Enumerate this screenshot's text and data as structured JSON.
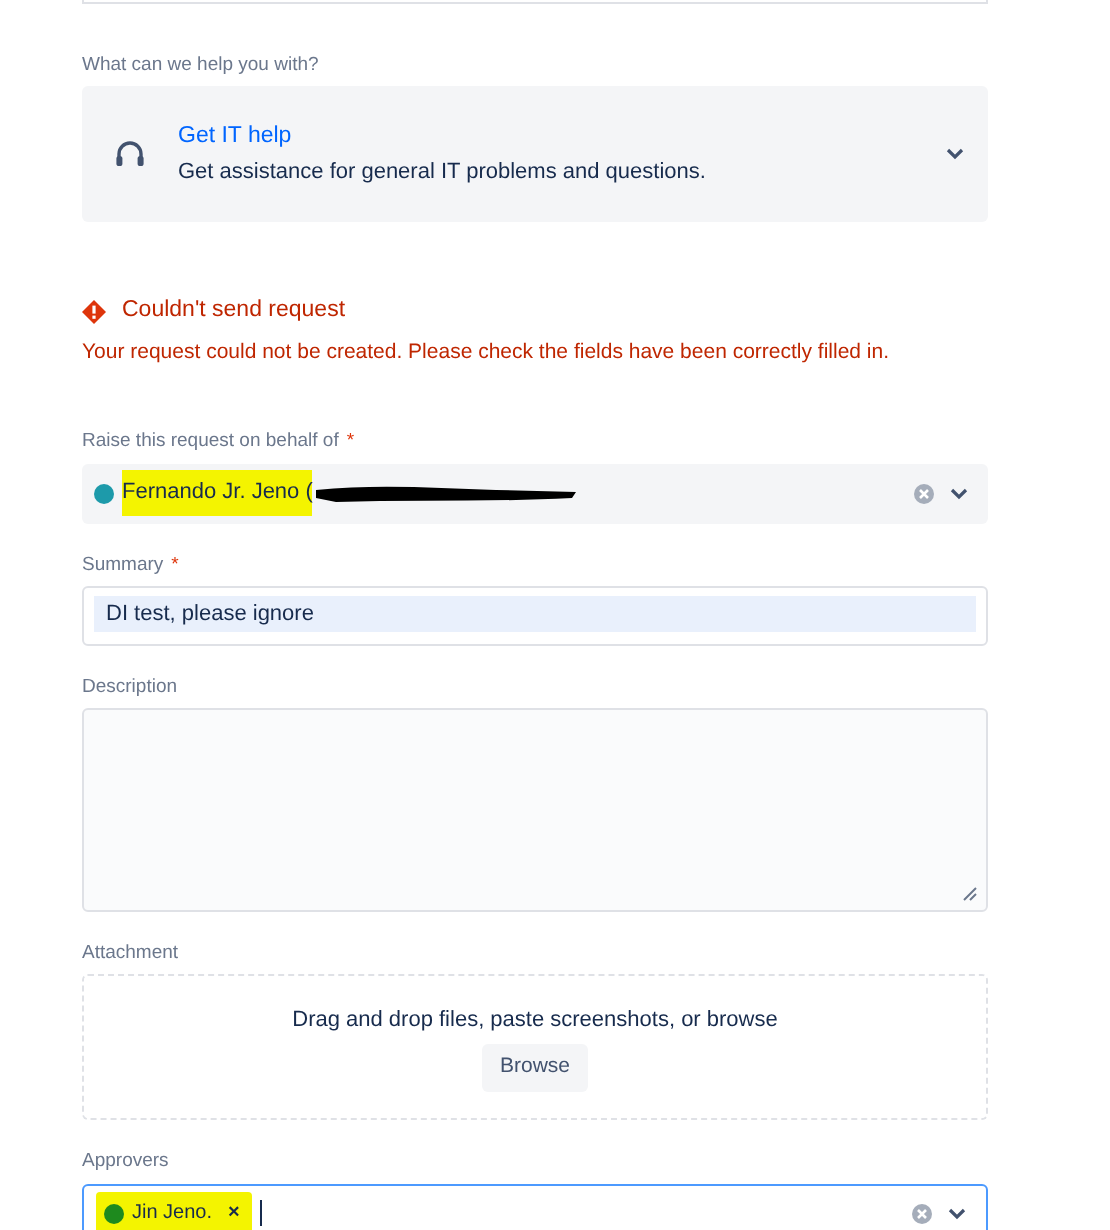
{
  "request_type": {
    "label": "What can we help you with?",
    "title": "Get IT help",
    "description": "Get assistance for general IT problems and questions."
  },
  "error": {
    "title": "Couldn't send request",
    "message": "Your request could not be created. Please check the fields have been correctly filled in."
  },
  "fields": [
    {
      "kind": "user-select",
      "label": "Raise this request on behalf of",
      "required_mark": "*",
      "value": "Fernando Jr. Jeno (",
      "highlighted": true,
      "redacted": true,
      "color": "#1d9aaa"
    },
    {
      "kind": "text",
      "label": "Summary",
      "required_mark": "*",
      "value": "DI test, please ignore"
    },
    {
      "kind": "textarea",
      "label": "Description"
    },
    {
      "kind": "attachment",
      "label": "Attachment",
      "hint": "Drag and drop files, paste screenshots, or browse",
      "button": "Browse"
    },
    {
      "kind": "multi-user",
      "label": "Approvers",
      "focused": true,
      "chips": [
        {
          "name": "Jin Jeno.",
          "remove": "×",
          "highlighted": true,
          "color": "#1e8a1e"
        }
      ]
    }
  ]
}
